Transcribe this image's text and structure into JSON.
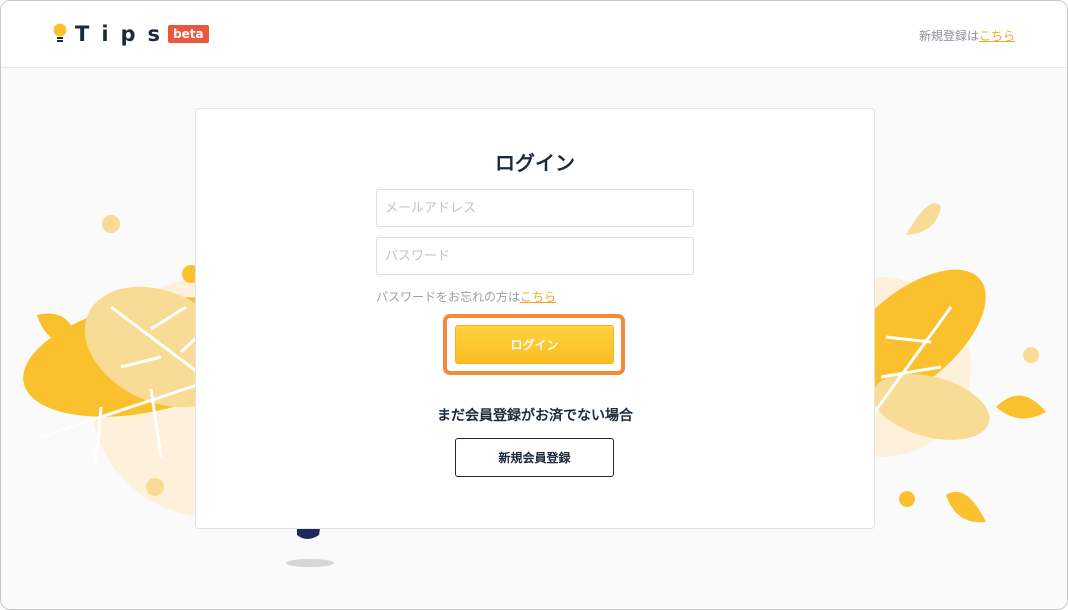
{
  "header": {
    "logo_text": "Tips",
    "beta_badge": "beta",
    "register_prefix": "新規登録は",
    "register_link": "こちら"
  },
  "login": {
    "title": "ログイン",
    "email_placeholder": "メールアドレス",
    "password_placeholder": "パスワード",
    "forgot_prefix": "パスワードをお忘れの方は",
    "forgot_link": "こちら",
    "submit_label": "ログイン",
    "not_member_text": "まだ会員登録がお済でない場合",
    "register_label": "新規会員登録"
  },
  "colors": {
    "accent": "#fbc02d",
    "highlight": "#f5893a",
    "brand_dark": "#1d2a3a",
    "beta_badge": "#e9573f",
    "link": "#f2a72b"
  }
}
